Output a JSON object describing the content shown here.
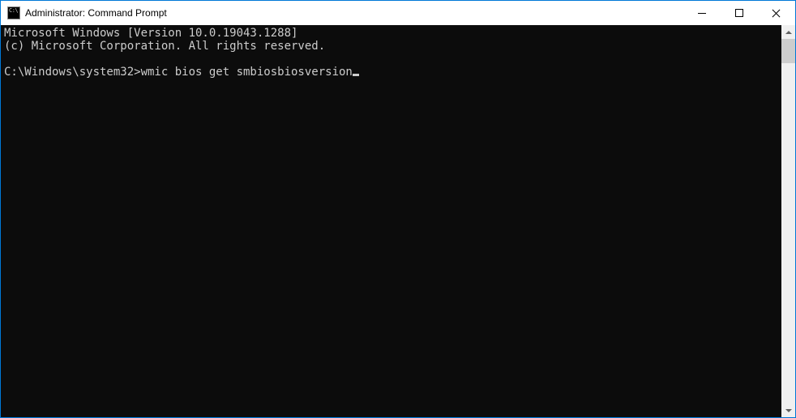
{
  "window": {
    "title": "Administrator: Command Prompt",
    "icon_glyph": "C:\\"
  },
  "terminal": {
    "lines": [
      "Microsoft Windows [Version 10.0.19043.1288]",
      "(c) Microsoft Corporation. All rights reserved.",
      "",
      "C:\\Windows\\system32>wmic bios get smbiosbiosversion"
    ]
  }
}
